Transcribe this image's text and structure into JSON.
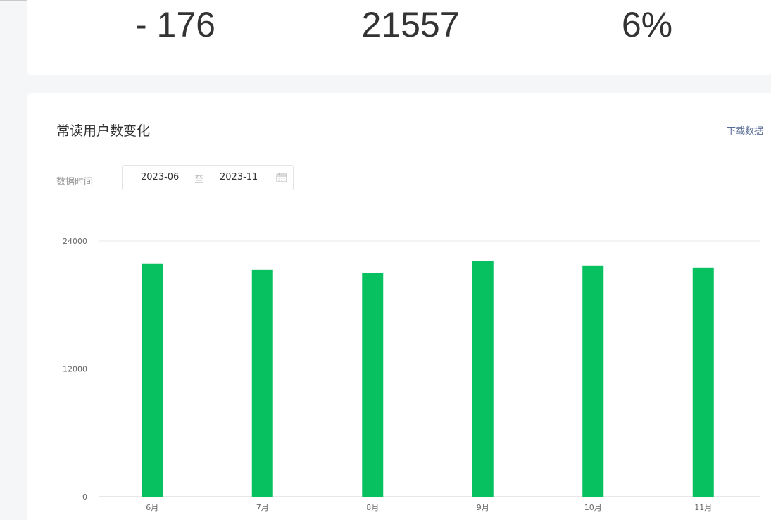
{
  "stats": [
    {
      "value": "- 176"
    },
    {
      "value": "21557"
    },
    {
      "value": "6%"
    }
  ],
  "section": {
    "title": "常读用户数变化",
    "download_label": "下载数据"
  },
  "date_filter": {
    "label": "数据时间",
    "start": "2023-06",
    "separator": "至",
    "end": "2023-11"
  },
  "colors": {
    "bar": "#07c160",
    "grid": "#e8e8e8",
    "axis_text": "#666666"
  },
  "chart_data": {
    "type": "bar",
    "categories": [
      "6月",
      "7月",
      "8月",
      "9月",
      "10月",
      "11月"
    ],
    "values": [
      21900,
      21300,
      21000,
      22100,
      21700,
      21500
    ],
    "yticks": [
      0,
      12000,
      24000
    ],
    "ylim": [
      0,
      24000
    ],
    "grid": true,
    "legend": "none"
  }
}
